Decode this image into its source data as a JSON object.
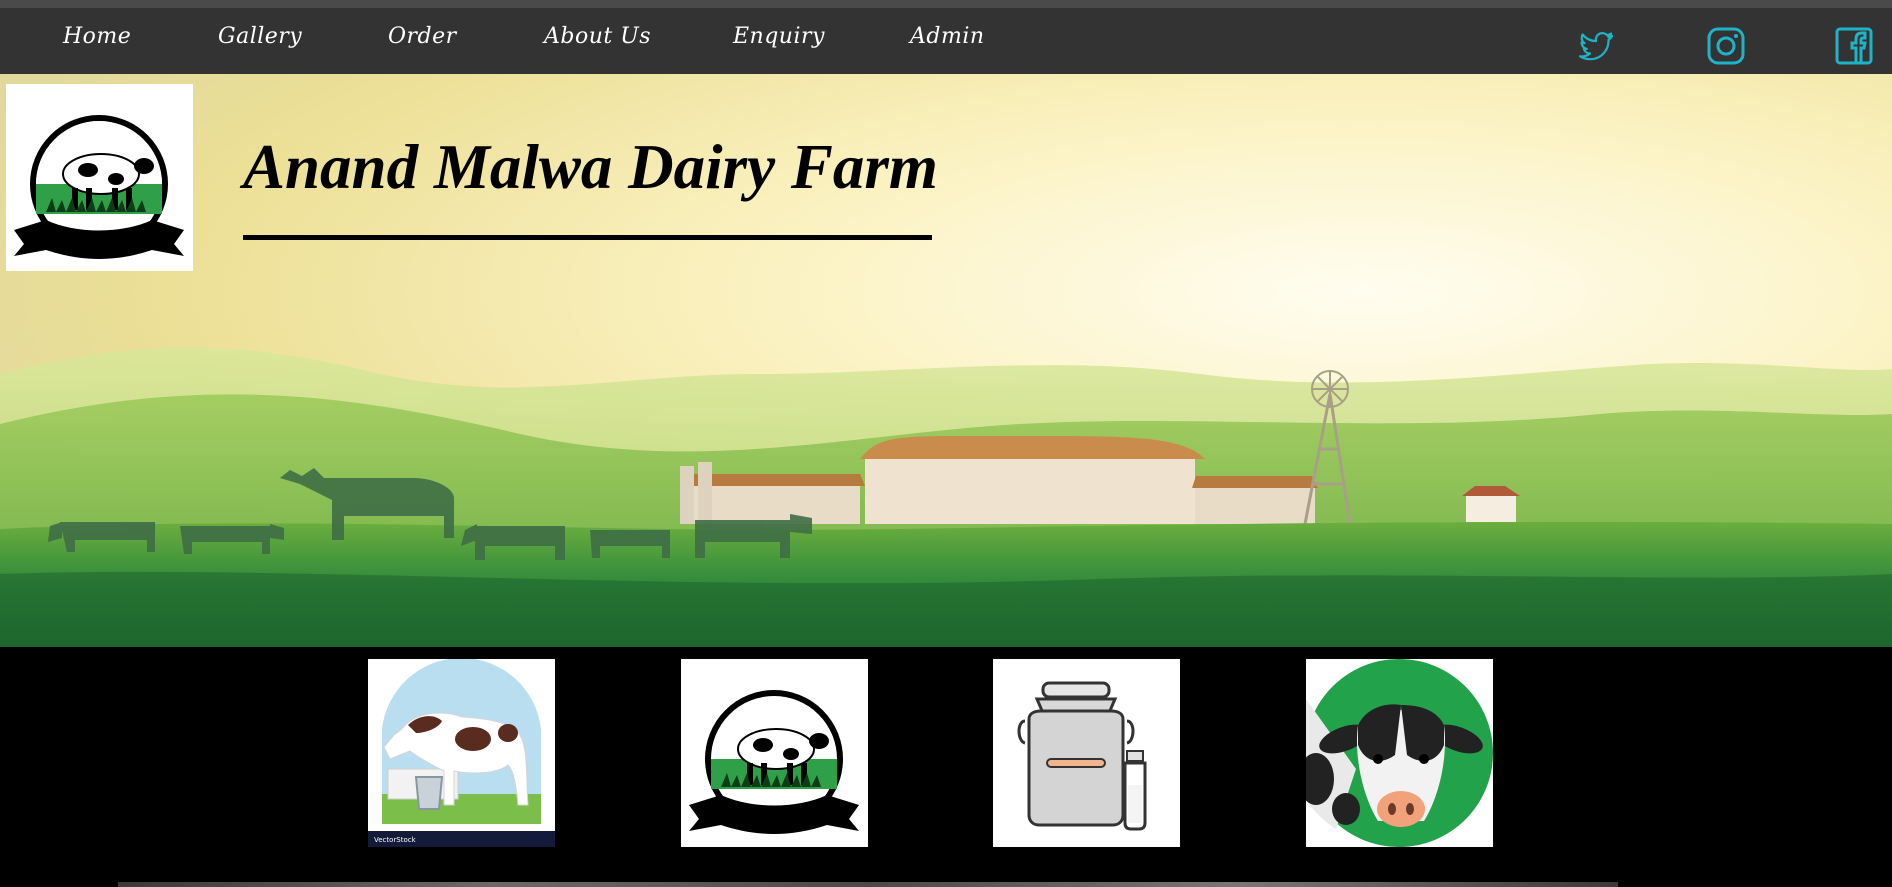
{
  "nav": {
    "items": [
      {
        "label": "Home"
      },
      {
        "label": "Gallery"
      },
      {
        "label": "Order"
      },
      {
        "label": "About Us"
      },
      {
        "label": "Enquiry"
      },
      {
        "label": "Admin"
      }
    ],
    "social": [
      {
        "icon": "twitter-icon"
      },
      {
        "icon": "instagram-icon"
      },
      {
        "icon": "facebook-icon"
      }
    ],
    "social_color": "#1fb3c7",
    "background": "#333333"
  },
  "hero": {
    "title": "Anand Malwa Dairy Farm",
    "scene": "farm-landscape-with-cows"
  },
  "logo": {
    "icon": "cow-logo-icon"
  },
  "features": [
    {
      "icon": "cow-with-milk-bucket-icon",
      "caption": "VectorStock"
    },
    {
      "icon": "cow-logo-icon"
    },
    {
      "icon": "milk-can-and-bottle-icon"
    },
    {
      "icon": "cow-face-icon"
    }
  ],
  "colors": {
    "feature_strip": "#000000",
    "accent_green": "#22a24a"
  }
}
